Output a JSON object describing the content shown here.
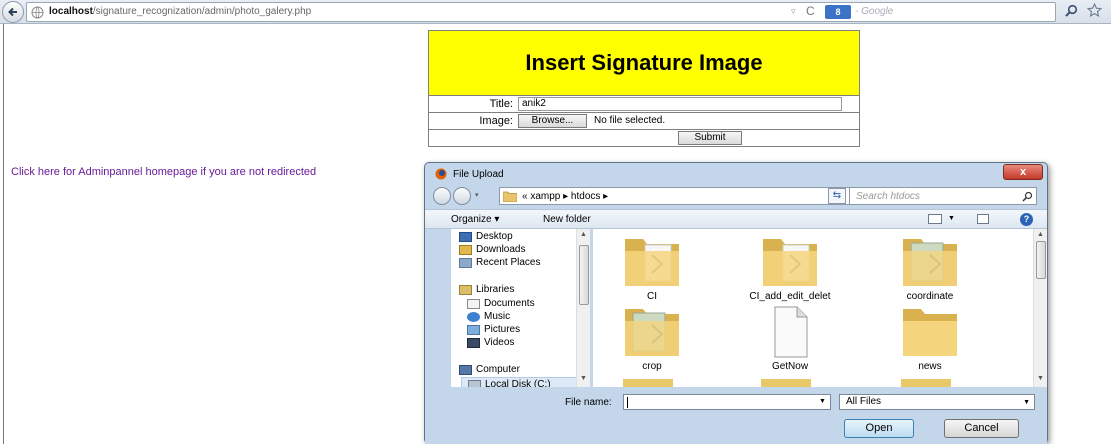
{
  "browser": {
    "url_host": "localhost",
    "url_path": "/signature_recognization/admin/photo_galery.php",
    "search_engine_label": "8",
    "search_engine_suffix": "- Google",
    "back_icon": "back-arrow-icon",
    "site_icon": "globe-icon",
    "reload_icon": "reload-icon"
  },
  "form": {
    "title": "Insert Signature Image",
    "title_bg": "#ffff00",
    "title_label": "Title:",
    "title_value": "anik2",
    "image_label": "Image:",
    "browse_label": "Browse...",
    "file_status": "No file selected.",
    "submit_label": "Submit"
  },
  "admin_link": "Click here for Adminpannel homepage if you are not redirected",
  "dialog": {
    "title": "File Upload",
    "close_label": "x",
    "breadcrumbs": "« xampp ▸ htdocs ▸",
    "search_placeholder": "Search htdocs",
    "organize_label": "Organize ▾",
    "new_folder_label": "New folder",
    "nav_items": [
      {
        "label": "Desktop",
        "icon": "desktop-icon"
      },
      {
        "label": "Downloads",
        "icon": "downloads-icon"
      },
      {
        "label": "Recent Places",
        "icon": "recent-places-icon"
      },
      {
        "label": "Libraries",
        "icon": "libraries-icon"
      },
      {
        "label": "Documents",
        "icon": "documents-icon"
      },
      {
        "label": "Music",
        "icon": "music-icon"
      },
      {
        "label": "Pictures",
        "icon": "pictures-icon"
      },
      {
        "label": "Videos",
        "icon": "videos-icon"
      },
      {
        "label": "Computer",
        "icon": "computer-icon"
      },
      {
        "label": "Local Disk (C:)",
        "icon": "disk-icon"
      }
    ],
    "files": [
      {
        "name": "CI",
        "kind": "folder"
      },
      {
        "name": "CI_add_edit_delet",
        "kind": "folder"
      },
      {
        "name": "coordinate",
        "kind": "php-folder"
      },
      {
        "name": "crop",
        "kind": "php-folder"
      },
      {
        "name": "GetNow",
        "kind": "file"
      },
      {
        "name": "news",
        "kind": "folder"
      }
    ],
    "file_name_label": "File name:",
    "file_name_value": "",
    "file_type": "All Files",
    "open_label": "Open",
    "cancel_label": "Cancel"
  }
}
